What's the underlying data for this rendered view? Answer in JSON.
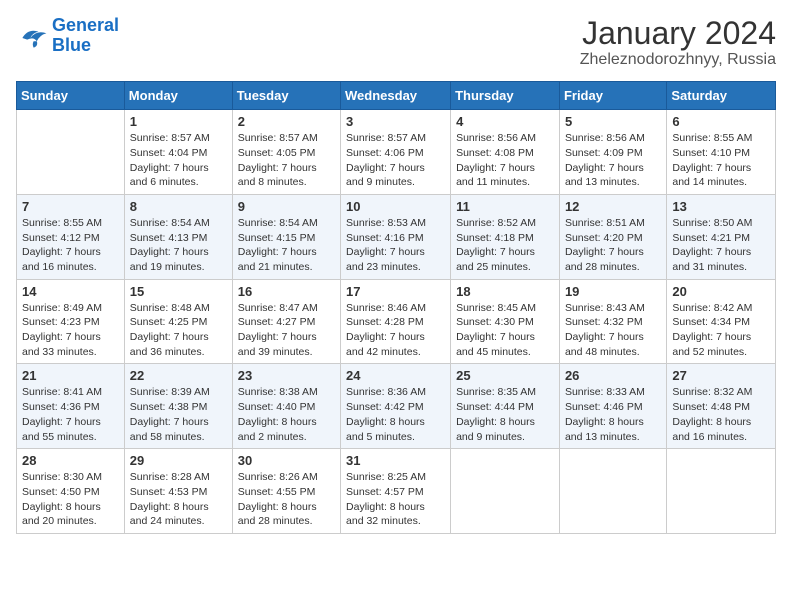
{
  "logo": {
    "line1": "General",
    "line2": "Blue"
  },
  "header": {
    "month": "January 2024",
    "location": "Zheleznodorozhnyy, Russia"
  },
  "weekdays": [
    "Sunday",
    "Monday",
    "Tuesday",
    "Wednesday",
    "Thursday",
    "Friday",
    "Saturday"
  ],
  "weeks": [
    [
      {
        "day": "",
        "info": ""
      },
      {
        "day": "1",
        "info": "Sunrise: 8:57 AM\nSunset: 4:04 PM\nDaylight: 7 hours\nand 6 minutes."
      },
      {
        "day": "2",
        "info": "Sunrise: 8:57 AM\nSunset: 4:05 PM\nDaylight: 7 hours\nand 8 minutes."
      },
      {
        "day": "3",
        "info": "Sunrise: 8:57 AM\nSunset: 4:06 PM\nDaylight: 7 hours\nand 9 minutes."
      },
      {
        "day": "4",
        "info": "Sunrise: 8:56 AM\nSunset: 4:08 PM\nDaylight: 7 hours\nand 11 minutes."
      },
      {
        "day": "5",
        "info": "Sunrise: 8:56 AM\nSunset: 4:09 PM\nDaylight: 7 hours\nand 13 minutes."
      },
      {
        "day": "6",
        "info": "Sunrise: 8:55 AM\nSunset: 4:10 PM\nDaylight: 7 hours\nand 14 minutes."
      }
    ],
    [
      {
        "day": "7",
        "info": "Sunrise: 8:55 AM\nSunset: 4:12 PM\nDaylight: 7 hours\nand 16 minutes."
      },
      {
        "day": "8",
        "info": "Sunrise: 8:54 AM\nSunset: 4:13 PM\nDaylight: 7 hours\nand 19 minutes."
      },
      {
        "day": "9",
        "info": "Sunrise: 8:54 AM\nSunset: 4:15 PM\nDaylight: 7 hours\nand 21 minutes."
      },
      {
        "day": "10",
        "info": "Sunrise: 8:53 AM\nSunset: 4:16 PM\nDaylight: 7 hours\nand 23 minutes."
      },
      {
        "day": "11",
        "info": "Sunrise: 8:52 AM\nSunset: 4:18 PM\nDaylight: 7 hours\nand 25 minutes."
      },
      {
        "day": "12",
        "info": "Sunrise: 8:51 AM\nSunset: 4:20 PM\nDaylight: 7 hours\nand 28 minutes."
      },
      {
        "day": "13",
        "info": "Sunrise: 8:50 AM\nSunset: 4:21 PM\nDaylight: 7 hours\nand 31 minutes."
      }
    ],
    [
      {
        "day": "14",
        "info": "Sunrise: 8:49 AM\nSunset: 4:23 PM\nDaylight: 7 hours\nand 33 minutes."
      },
      {
        "day": "15",
        "info": "Sunrise: 8:48 AM\nSunset: 4:25 PM\nDaylight: 7 hours\nand 36 minutes."
      },
      {
        "day": "16",
        "info": "Sunrise: 8:47 AM\nSunset: 4:27 PM\nDaylight: 7 hours\nand 39 minutes."
      },
      {
        "day": "17",
        "info": "Sunrise: 8:46 AM\nSunset: 4:28 PM\nDaylight: 7 hours\nand 42 minutes."
      },
      {
        "day": "18",
        "info": "Sunrise: 8:45 AM\nSunset: 4:30 PM\nDaylight: 7 hours\nand 45 minutes."
      },
      {
        "day": "19",
        "info": "Sunrise: 8:43 AM\nSunset: 4:32 PM\nDaylight: 7 hours\nand 48 minutes."
      },
      {
        "day": "20",
        "info": "Sunrise: 8:42 AM\nSunset: 4:34 PM\nDaylight: 7 hours\nand 52 minutes."
      }
    ],
    [
      {
        "day": "21",
        "info": "Sunrise: 8:41 AM\nSunset: 4:36 PM\nDaylight: 7 hours\nand 55 minutes."
      },
      {
        "day": "22",
        "info": "Sunrise: 8:39 AM\nSunset: 4:38 PM\nDaylight: 7 hours\nand 58 minutes."
      },
      {
        "day": "23",
        "info": "Sunrise: 8:38 AM\nSunset: 4:40 PM\nDaylight: 8 hours\nand 2 minutes."
      },
      {
        "day": "24",
        "info": "Sunrise: 8:36 AM\nSunset: 4:42 PM\nDaylight: 8 hours\nand 5 minutes."
      },
      {
        "day": "25",
        "info": "Sunrise: 8:35 AM\nSunset: 4:44 PM\nDaylight: 8 hours\nand 9 minutes."
      },
      {
        "day": "26",
        "info": "Sunrise: 8:33 AM\nSunset: 4:46 PM\nDaylight: 8 hours\nand 13 minutes."
      },
      {
        "day": "27",
        "info": "Sunrise: 8:32 AM\nSunset: 4:48 PM\nDaylight: 8 hours\nand 16 minutes."
      }
    ],
    [
      {
        "day": "28",
        "info": "Sunrise: 8:30 AM\nSunset: 4:50 PM\nDaylight: 8 hours\nand 20 minutes."
      },
      {
        "day": "29",
        "info": "Sunrise: 8:28 AM\nSunset: 4:53 PM\nDaylight: 8 hours\nand 24 minutes."
      },
      {
        "day": "30",
        "info": "Sunrise: 8:26 AM\nSunset: 4:55 PM\nDaylight: 8 hours\nand 28 minutes."
      },
      {
        "day": "31",
        "info": "Sunrise: 8:25 AM\nSunset: 4:57 PM\nDaylight: 8 hours\nand 32 minutes."
      },
      {
        "day": "",
        "info": ""
      },
      {
        "day": "",
        "info": ""
      },
      {
        "day": "",
        "info": ""
      }
    ]
  ]
}
